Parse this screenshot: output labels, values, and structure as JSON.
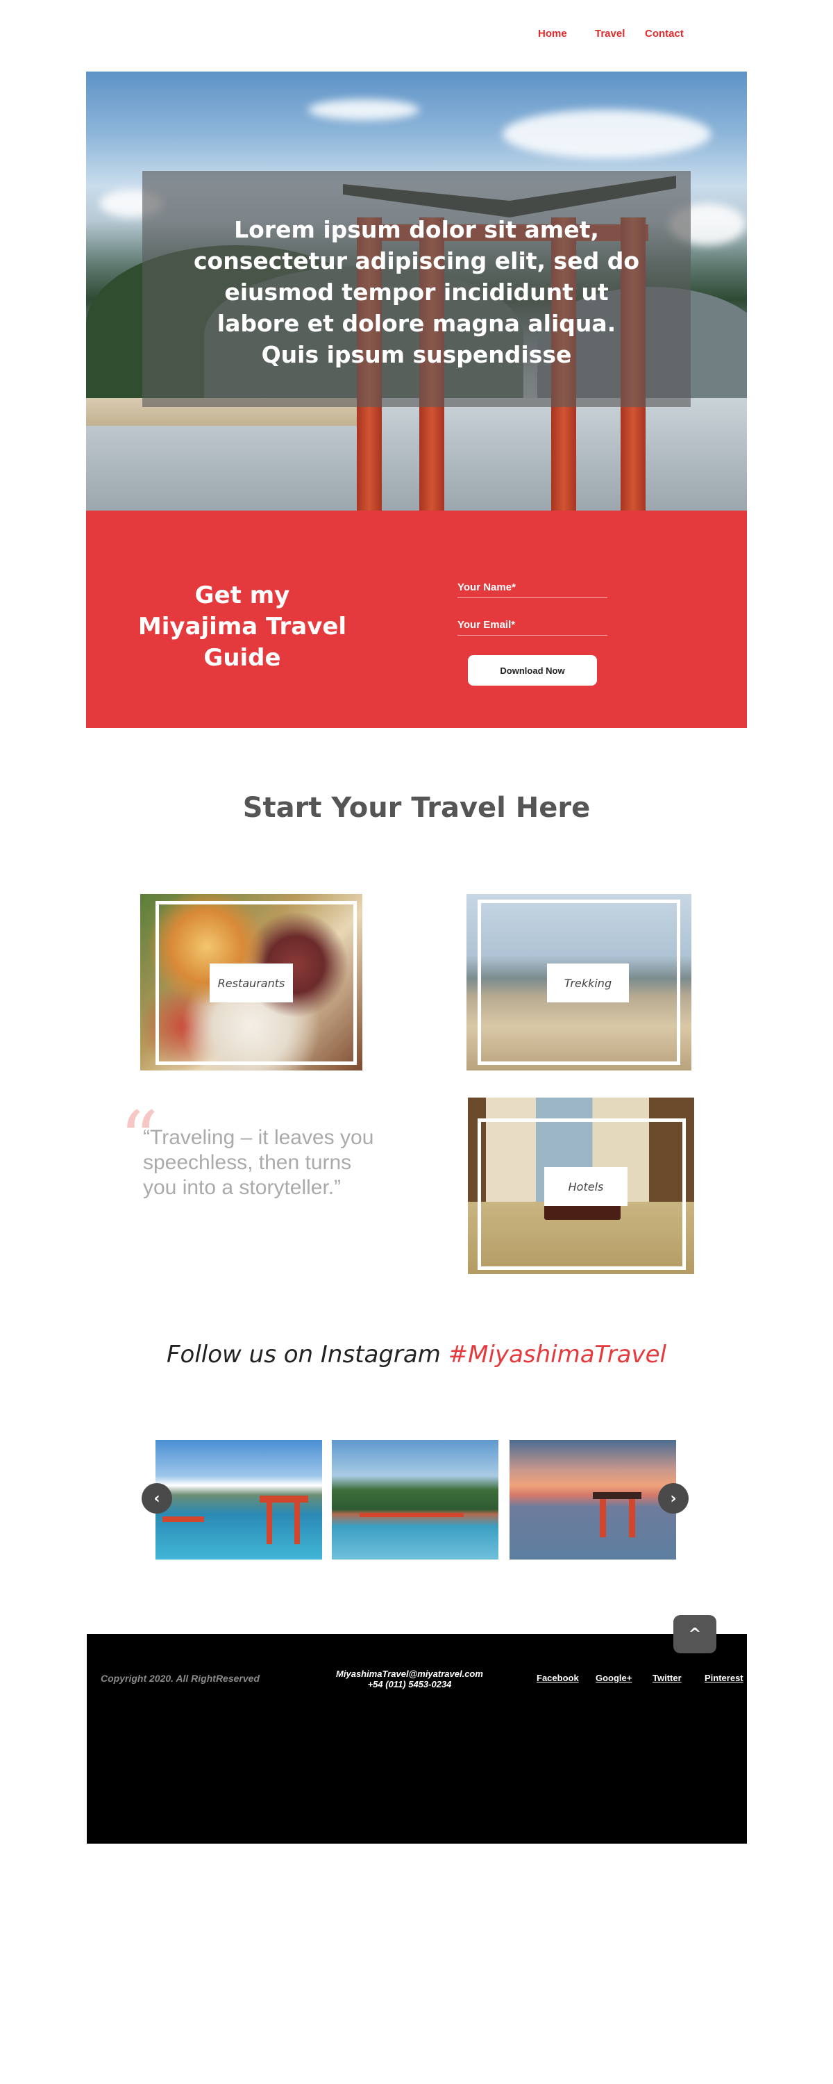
{
  "nav": {
    "items": [
      "Home",
      "Travel",
      "Contact"
    ]
  },
  "hero": {
    "headline": "Lorem ipsum dolor sit amet, consectetur adipiscing elit, sed do eiusmod tempor incididunt ut labore et dolore magna aliqua. Quis ipsum suspendisse"
  },
  "guide": {
    "title": "Get my Miyajima Travel Guide",
    "name_label": "Your Name*",
    "email_label": "Your Email*",
    "button_label": "Download Now"
  },
  "start": {
    "title": "Start Your Travel Here",
    "cards": [
      "Restaurants",
      "Trekking",
      "Hotels"
    ],
    "quote_mark": "“",
    "quote": "“Traveling – it leaves you speechless, then turns you into a storyteller.”"
  },
  "instagram": {
    "lead": "Follow us on Instagram ",
    "hashtag": "#MiyashimaTravel",
    "prev_label": "‹",
    "next_label": "›"
  },
  "footer": {
    "to_top_label": "^",
    "copyright": "Copyright 2020. All RightReserved",
    "email": "MiyashimaTravel@miyatravel.com",
    "phone": "+54 (011) 5453-0234",
    "social": [
      "Facebook",
      "Google+",
      "Twitter",
      "Pinterest"
    ]
  },
  "colors": {
    "accent": "#e53a3d",
    "footer_bg": "#000000"
  },
  "icons": {
    "prev": "chevron-left-icon",
    "next": "chevron-right-icon",
    "to_top": "arrow-up-icon",
    "quote": "quote-icon"
  }
}
